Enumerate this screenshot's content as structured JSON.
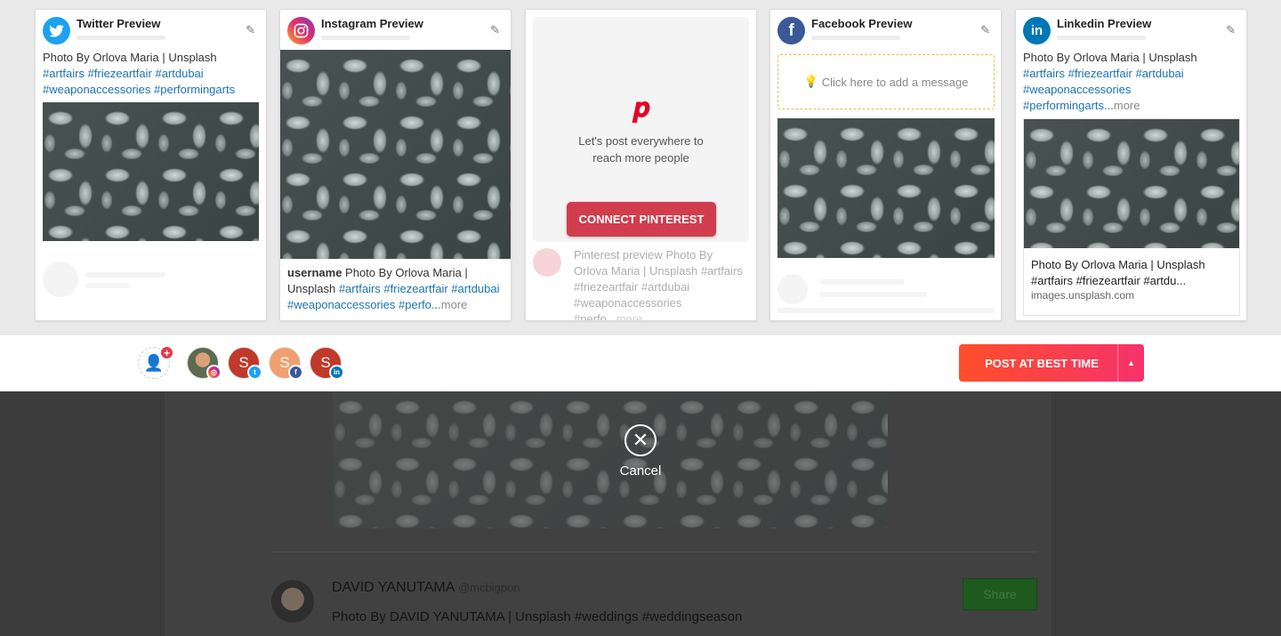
{
  "twitter": {
    "title": "Twitter Preview",
    "text": "Photo By Orlova Maria | Unsplash",
    "tags": [
      "#artfairs",
      "#friezeartfair",
      "#artdubai",
      "#weaponaccessories",
      "#performingarts"
    ]
  },
  "instagram": {
    "title": "Instagram Preview",
    "username": "username",
    "text": "Photo By Orlova Maria | Unsplash",
    "tags": [
      "#artfairs",
      "#friezeartfair",
      "#artdubai",
      "#weaponaccessories",
      "#perfo..."
    ],
    "more": "more"
  },
  "pinterest": {
    "line1": "Let's post everywhere to",
    "line2": "reach more people",
    "connect": "CONNECT PINTEREST",
    "preview_text": "Pinterest preview Photo By Orlova Maria | Unsplash #artfairs #friezeartfair #artdubai #weaponaccessories #perfo...",
    "more": "more"
  },
  "facebook": {
    "title": "Facebook Preview",
    "placeholder": "Click here to add a message"
  },
  "linkedin": {
    "title": "Linkedin Preview",
    "text": "Photo By Orlova Maria | Unsplash",
    "tags": [
      "#artfairs",
      "#friezeartfair",
      "#artdubai",
      "#weaponaccessories",
      "#performingarts..."
    ],
    "more": "more",
    "link_title": "Photo By Orlova Maria | Unsplash #artfairs #friezeartfair #artdu...",
    "domain": "images.unsplash.com"
  },
  "accounts": [
    {
      "letter": "",
      "network": "instagram"
    },
    {
      "letter": "S",
      "network": "twitter"
    },
    {
      "letter": "S",
      "network": "facebook"
    },
    {
      "letter": "S",
      "network": "linkedin"
    }
  ],
  "post_button": {
    "label": "POST AT BEST TIME"
  },
  "cancel": {
    "label": "Cancel"
  },
  "feed": {
    "author": "DAVID YANUTAMA",
    "handle": "@mcbigpon",
    "text": "Photo By DAVID YANUTAMA | Unsplash #weddings #weddingseason",
    "share": "Share"
  },
  "colors": {
    "twitter": "#1da1f2",
    "facebook": "#3b5998",
    "linkedin": "#0077b5",
    "pinterest": "#e60023",
    "connect": "#d13d4d",
    "post_start": "#ff4e2a",
    "post_end": "#f5326b",
    "share": "#1e5a1e"
  }
}
